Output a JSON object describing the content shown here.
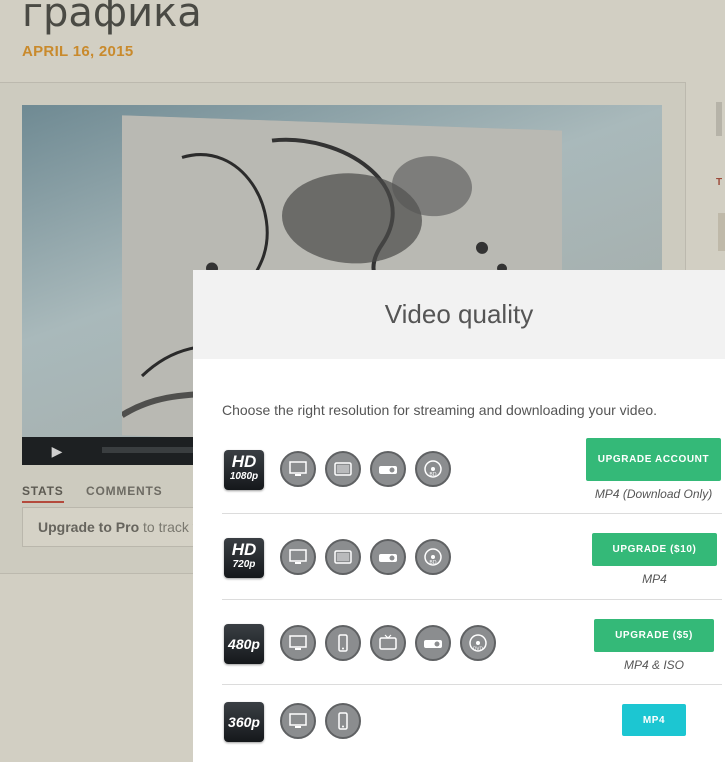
{
  "post": {
    "title": "графика",
    "date": "APRIL 16, 2015"
  },
  "tabs": [
    {
      "label": "STATS"
    },
    {
      "label": "COMMENTS"
    }
  ],
  "upgrade_prompt": {
    "bold": "Upgrade to Pro",
    "rest": " to track v"
  },
  "side_letter": "T",
  "modal": {
    "title": "Video quality",
    "intro": "Choose the right resolution for streaming and downloading your video.",
    "rows": [
      {
        "badge_top": "HD",
        "badge_bottom": "1080p",
        "devices": [
          "monitor-icon",
          "tablet-landscape-icon",
          "projector-icon",
          "bluray-disc-icon"
        ],
        "button": "UPGRADE ACCOUNT",
        "format": "MP4 (Download Only)"
      },
      {
        "badge_top": "HD",
        "badge_bottom": "720p",
        "devices": [
          "monitor-icon",
          "tablet-landscape-icon",
          "projector-icon",
          "bluray-disc-icon"
        ],
        "button": "UPGRADE ($10)",
        "format": "MP4"
      },
      {
        "badge_top": "480p",
        "badge_bottom": "",
        "devices": [
          "monitor-icon",
          "phone-icon",
          "tv-icon",
          "projector-icon",
          "dvd-disc-icon"
        ],
        "button": "UPGRADE ($5)",
        "format": "MP4 & ISO"
      },
      {
        "badge_top": "360p",
        "badge_bottom": "",
        "devices": [
          "monitor-icon",
          "phone-icon"
        ],
        "button": "MP4",
        "format": ""
      }
    ]
  },
  "colors": {
    "accent_green": "#34b978",
    "accent_teal": "#1cc6d2",
    "date_color": "#c98a2c"
  }
}
